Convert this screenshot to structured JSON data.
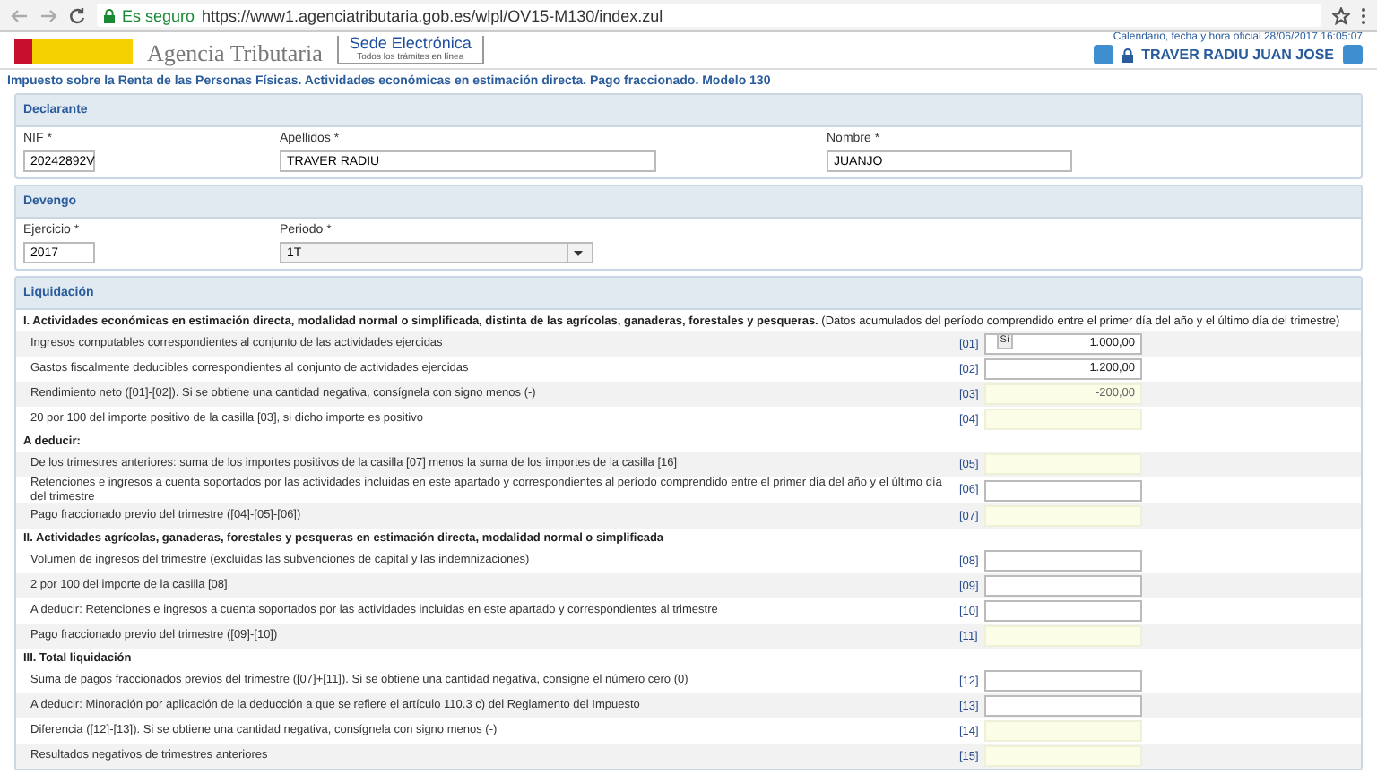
{
  "browser": {
    "security": "Es seguro",
    "url": "https://www1.agenciatributaria.gob.es/wlpl/OV15-M130/index.zul"
  },
  "header": {
    "agency": "Agencia Tributaria",
    "sede": "Sede Electrónica",
    "sede_sub": "Todos los trámites en línea",
    "calendar": "Calendario, fecha y hora oficial 28/06/2017 16:05:07",
    "user": "TRAVER RADIU JUAN JOSE"
  },
  "page_title": "Impuesto sobre la Renta de las Personas Físicas. Actividades económicas en estimación directa. Pago fraccionado. Modelo 130",
  "declarante": {
    "title": "Declarante",
    "fields": [
      {
        "label": "NIF *",
        "value": "20242892V",
        "kind": "text"
      },
      {
        "label": "Apellidos *",
        "value": "TRAVER RADIU",
        "kind": "text"
      },
      {
        "label": "Nombre *",
        "value": "JUANJO",
        "kind": "text"
      }
    ]
  },
  "devengo": {
    "title": "Devengo",
    "fields": [
      {
        "label": "Ejercicio *",
        "value": "2017",
        "kind": "text"
      },
      {
        "label": "Periodo *",
        "value": "1T",
        "kind": "select"
      }
    ]
  },
  "liquidacion": {
    "title": "Liquidación",
    "tooltip": "Sí",
    "rows": [
      {
        "kind": "heading",
        "text": "I. Actividades económicas en estimación directa, modalidad normal o simplificada, distinta de las agrícolas, ganaderas, forestales y pesqueras.",
        "note": "(Datos acumulados del período comprendido entre el primer día del año y el último día del trimestre)"
      },
      {
        "kind": "input",
        "text": "Ingresos computables correspondientes al conjunto de las actividades ejercidas",
        "code": "[01]",
        "value": "1.000,00"
      },
      {
        "kind": "input",
        "text": "Gastos fiscalmente deducibles correspondientes al conjunto de actividades ejercidas",
        "code": "[02]",
        "value": "1.200,00"
      },
      {
        "kind": "computed",
        "text": "Rendimiento neto ([01]-[02]). Si se obtiene una cantidad negativa, consígnela con signo menos (-)",
        "code": "[03]",
        "value": "-200,00"
      },
      {
        "kind": "computed",
        "text": "20 por 100 del importe positivo de la casilla [03], si dicho importe es positivo",
        "code": "[04]"
      },
      {
        "kind": "heading",
        "text": "A deducir:"
      },
      {
        "kind": "computed",
        "text": "De los trimestres anteriores: suma de los importes positivos de la casilla [07] menos la suma de los importes de la casilla [16]",
        "code": "[05]"
      },
      {
        "kind": "input",
        "text": "Retenciones e ingresos a cuenta soportados por las actividades incluidas en este apartado y correspondientes al período comprendido entre el primer día del año y el último día del trimestre",
        "code": "[06]"
      },
      {
        "kind": "computed",
        "text": "Pago fraccionado previo del trimestre ([04]-[05]-[06])",
        "code": "[07]"
      },
      {
        "kind": "heading",
        "text": "II. Actividades agrícolas, ganaderas, forestales y pesqueras en estimación directa, modalidad normal o simplificada"
      },
      {
        "kind": "input",
        "text": "Volumen de ingresos del trimestre (excluidas las subvenciones de capital y las indemnizaciones)",
        "code": "[08]"
      },
      {
        "kind": "input",
        "text": "2 por 100 del importe de la casilla [08]",
        "code": "[09]"
      },
      {
        "kind": "input",
        "text": "A deducir: Retenciones e ingresos a cuenta soportados por las actividades incluidas en este apartado y correspondientes al trimestre",
        "code": "[10]"
      },
      {
        "kind": "computed",
        "text": "Pago fraccionado previo del trimestre ([09]-[10])",
        "code": "[11]"
      },
      {
        "kind": "heading",
        "text": "III. Total liquidación"
      },
      {
        "kind": "input",
        "text": "Suma de pagos fraccionados previos del trimestre ([07]+[11]). Si se obtiene una cantidad negativa, consigne el número cero (0)",
        "code": "[12]"
      },
      {
        "kind": "input",
        "text": "A deducir: Minoración por aplicación de la deducción a que se refiere el artículo 110.3 c) del Reglamento del Impuesto",
        "code": "[13]"
      },
      {
        "kind": "computed",
        "text": "Diferencia ([12]-[13]). Si se obtiene una cantidad negativa, consígnela con signo menos (-)",
        "code": "[14]"
      },
      {
        "kind": "computed",
        "text": "Resultados negativos de trimestres anteriores",
        "code": "[15]"
      }
    ]
  }
}
